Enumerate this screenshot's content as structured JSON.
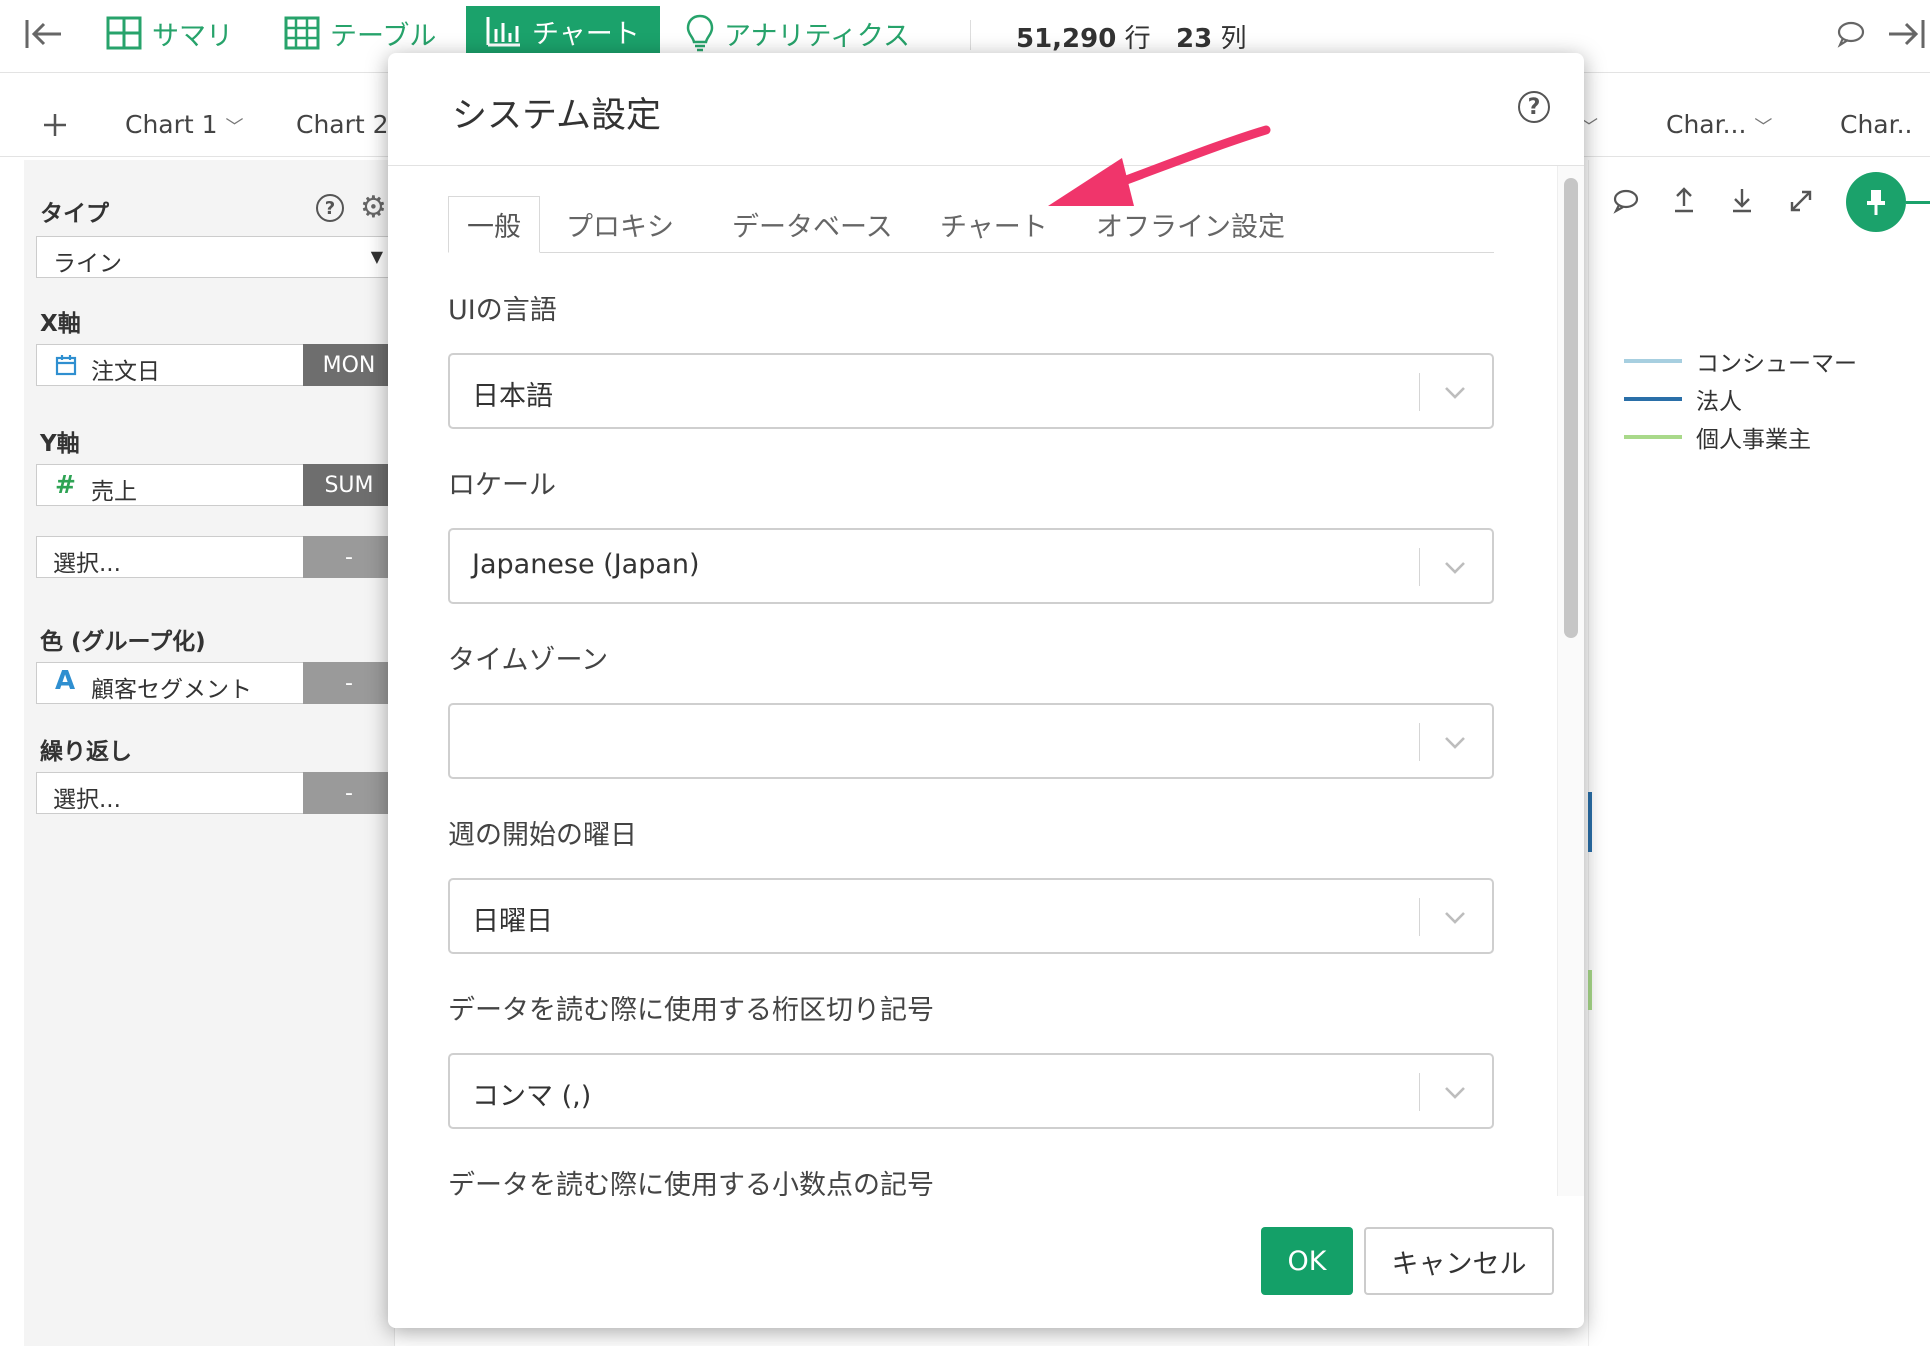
{
  "topnav": {
    "items": [
      {
        "label": "サマリ",
        "icon": "grid-icon"
      },
      {
        "label": "テーブル",
        "icon": "table-icon"
      },
      {
        "label": "チャート",
        "icon": "bar-chart-icon"
      },
      {
        "label": "アナリティクス",
        "icon": "lightbulb-icon"
      }
    ],
    "rows_value": "51,290",
    "rows_unit": "行",
    "cols_value": "23",
    "cols_unit": "列"
  },
  "chart_tabs": {
    "tab1": "Chart 1",
    "tab2": "Chart 2",
    "tab_right1": "Char...",
    "tab_right2": "Char.."
  },
  "left_panel": {
    "type_label": "タイプ",
    "type_value": "ライン",
    "x_label": "X軸",
    "x_field": "注文日",
    "x_agg": "MON",
    "y_label": "Y軸",
    "y_field": "売上",
    "y_agg": "SUM",
    "y2_field": "選択...",
    "y2_agg": "-",
    "color_label": "色 (グループ化)",
    "color_field": "顧客セグメント",
    "color_agg": "-",
    "repeat_label": "繰り返し",
    "repeat_field": "選択...",
    "repeat_agg": "-"
  },
  "legend": [
    {
      "name": "コンシューマー",
      "color": "#a7cfe0"
    },
    {
      "name": "法人",
      "color": "#2a6fa8"
    },
    {
      "name": "個人事業主",
      "color": "#a9d98a"
    }
  ],
  "modal": {
    "title": "システム設定",
    "tabs": [
      "一般",
      "プロキシ",
      "データベース",
      "チャート",
      "オフライン設定"
    ],
    "active_tab": "一般",
    "fields": {
      "ui_language_label": "UIの言語",
      "ui_language_value": "日本語",
      "locale_label": "ロケール",
      "locale_value": "Japanese (Japan)",
      "timezone_label": "タイムゾーン",
      "timezone_value": "",
      "week_start_label": "週の開始の曜日",
      "week_start_value": "日曜日",
      "thousands_sep_label": "データを読む際に使用する桁区切り記号",
      "thousands_sep_value": "コンマ (,)",
      "decimal_sep_label": "データを読む際に使用する小数点の記号"
    },
    "ok_label": "OK",
    "cancel_label": "キャンセル"
  },
  "colors": {
    "accent": "#1ba26b",
    "annotation_arrow": "#f0356b"
  }
}
